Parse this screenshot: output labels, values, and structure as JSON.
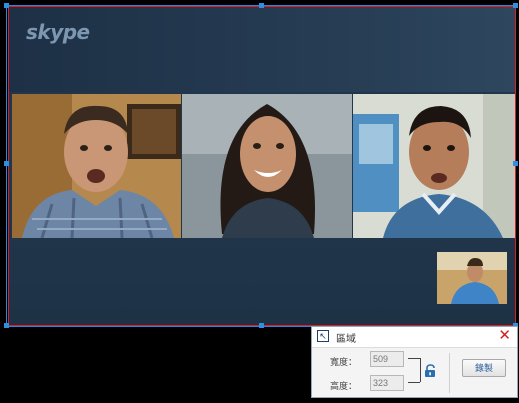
{
  "app": {
    "logo_text": "skype"
  },
  "participants": [
    {
      "id": "man-left",
      "shirt": "#6e86a5"
    },
    {
      "id": "woman-center",
      "shirt": "#2e3c4c"
    },
    {
      "id": "man-right",
      "shirt": "#3f6f9c"
    }
  ],
  "region_panel": {
    "title": "區域",
    "width_label": "寬度：",
    "width_value": "509",
    "height_label": "高度：",
    "height_value": "323",
    "record_label": "錄製",
    "close_icon": "close-icon",
    "lock_icon": "unlock-icon"
  },
  "colors": {
    "selection_border": "#d2222c",
    "handle": "#2f8fe0",
    "close": "#d32222"
  }
}
